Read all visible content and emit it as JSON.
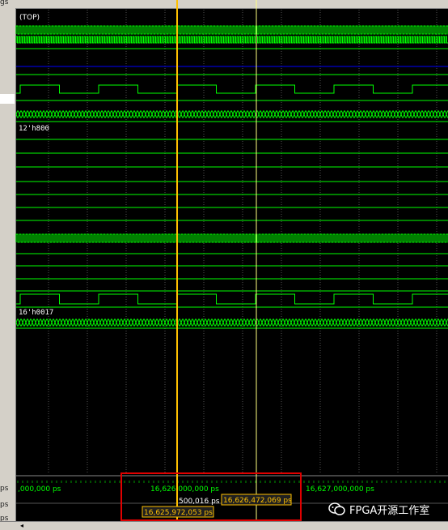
{
  "header": {
    "gutter_label": "gs"
  },
  "waveform": {
    "scope_label": "(TOP)",
    "bus_label_1": "12'h800",
    "bus_label_2": "16'h0017",
    "colors": {
      "signal": "#00ff00",
      "bus": "#00ff00",
      "blue_line": "#0000ff",
      "primary_cursor": "#ffc000",
      "secondary_cursor": "#ffff80",
      "grid": "#8a8a8a",
      "highlight_box": "#e00000"
    }
  },
  "timeline": {
    "tick_labels": [
      ",000,000 ps",
      "16,626,000,000 ps",
      "16,627,000,000 ps"
    ],
    "delta_label": "500,016 ps",
    "cursor_a_time": "16,625,972,053 ps",
    "cursor_b_time": "16,626,472,069 ps",
    "row_labels": [
      "ps",
      "ps",
      "ps"
    ]
  },
  "scrollbar": {
    "left_arrow": "◂"
  },
  "watermark": {
    "text": "FPGA开源工作室",
    "icon": "wechat-icon"
  }
}
